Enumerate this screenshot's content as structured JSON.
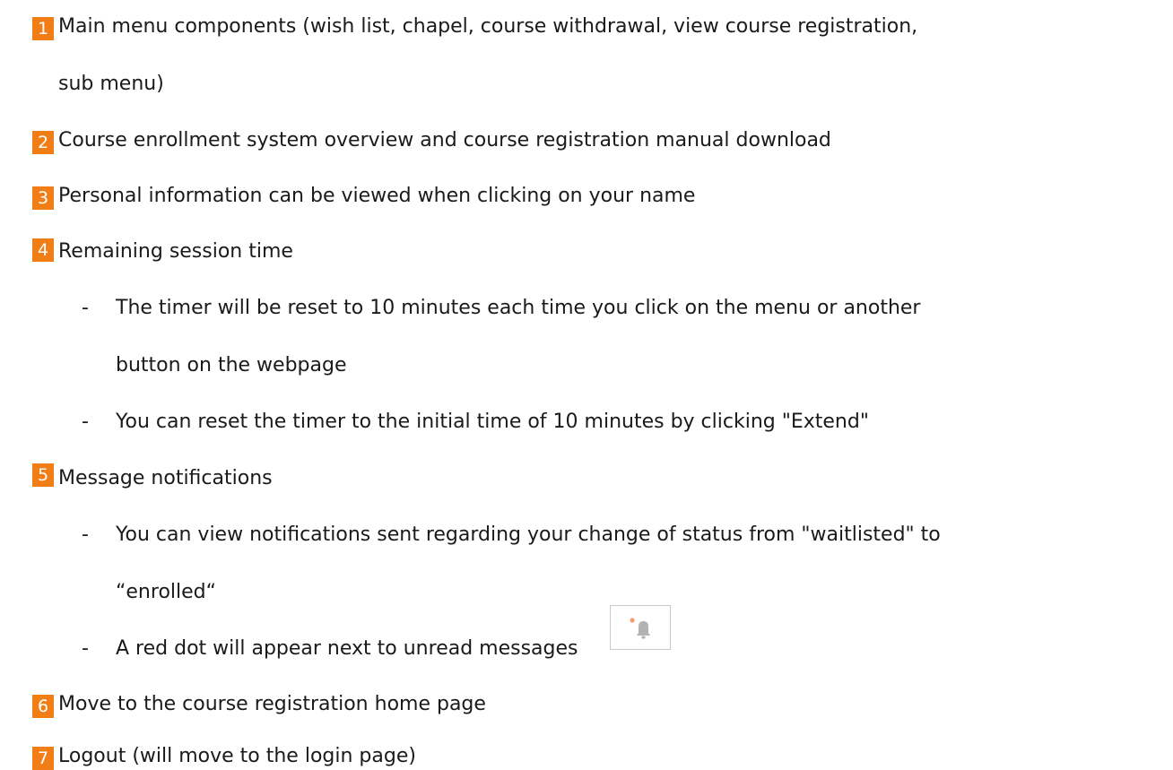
{
  "items": [
    {
      "number": "1",
      "lines": [
        "Main menu components (wish list, chapel, course withdrawal, view course registration,",
        "sub menu)"
      ]
    },
    {
      "number": "2",
      "lines": [
        "Course enrollment system overview and course registration manual download"
      ]
    },
    {
      "number": "3",
      "lines": [
        "Personal information can be viewed when clicking on your name"
      ]
    },
    {
      "number": "4",
      "lines": [
        "Remaining session time"
      ],
      "subitems": [
        {
          "dash": "-",
          "lines": [
            "The timer will be reset to 10 minutes each time you click on the menu or another",
            "button on the webpage"
          ]
        },
        {
          "dash": "-",
          "lines": [
            "You can reset the timer to the initial time of 10 minutes by clicking \"Extend\""
          ]
        }
      ]
    },
    {
      "number": "5",
      "lines": [
        "Message notifications"
      ],
      "subitems": [
        {
          "dash": "-",
          "lines": [
            "You can view notifications sent regarding your change of status from \"waitlisted\" to",
            "“enrolled“"
          ]
        },
        {
          "dash": "-",
          "lines": [
            "A red dot will appear next to unread messages"
          ]
        }
      ]
    },
    {
      "number": "6",
      "lines": [
        "Move to the course registration home page"
      ]
    },
    {
      "number": "7",
      "lines": [
        "Logout (will move to the login page)"
      ]
    }
  ],
  "bell_image": {
    "icon": "bell-icon",
    "dot_icon": "unread-dot-icon",
    "dot_color": "#f5a06a",
    "bell_color": "#b3b3b3"
  },
  "colors": {
    "badge": "#f07d16",
    "badge_text": "#ffffff",
    "text": "#1a1a1a"
  }
}
